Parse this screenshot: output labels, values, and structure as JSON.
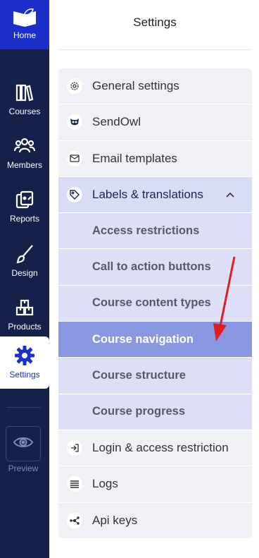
{
  "rail": {
    "home": "Home",
    "items": [
      {
        "label": "Courses",
        "icon": "books-icon"
      },
      {
        "label": "Members",
        "icon": "members-icon"
      },
      {
        "label": "Reports",
        "icon": "reports-icon"
      },
      {
        "label": "Design",
        "icon": "paintbrush-icon"
      },
      {
        "label": "Products",
        "icon": "boxes-icon"
      },
      {
        "label": "Settings",
        "icon": "gear-icon"
      }
    ],
    "preview": "Preview"
  },
  "panel": {
    "title": "Settings",
    "items": [
      {
        "label": "General settings",
        "icon": "gear-icon"
      },
      {
        "label": "SendOwl",
        "icon": "owl-icon"
      },
      {
        "label": "Email templates",
        "icon": "envelope-icon"
      },
      {
        "label": "Labels & translations",
        "icon": "tag-icon"
      },
      {
        "label": "Login & access restriction",
        "icon": "login-icon"
      },
      {
        "label": "Logs",
        "icon": "list-icon"
      },
      {
        "label": "Api keys",
        "icon": "nodes-icon"
      }
    ],
    "sub_items": [
      "Access restrictions",
      "Call to action buttons",
      "Course content types",
      "Course navigation",
      "Course structure",
      "Course progress"
    ],
    "selected_sub": "Course navigation"
  },
  "colors": {
    "rail_bg": "#16214a",
    "home_bg": "#1a30c9",
    "accent": "#1a30c9",
    "selected_bg": "#8a98e2",
    "annotation_arrow": "#e02020"
  }
}
